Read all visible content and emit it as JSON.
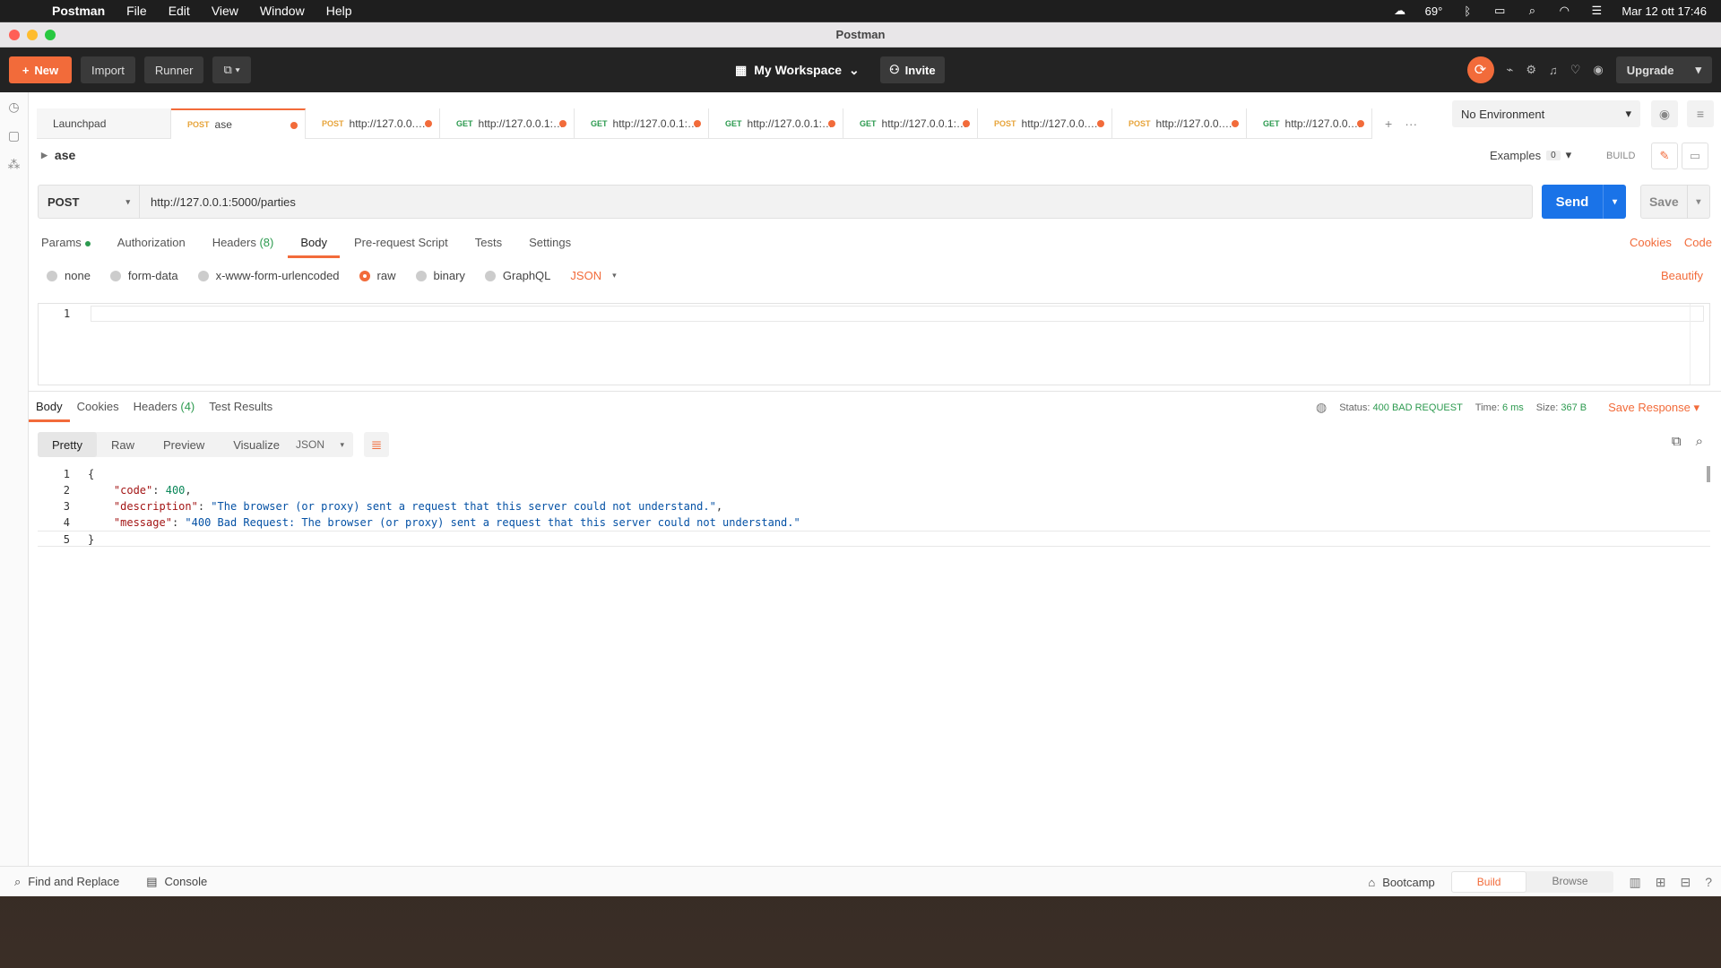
{
  "menubar": {
    "app": "Postman",
    "items": [
      "File",
      "Edit",
      "View",
      "Window",
      "Help"
    ],
    "temp": "69°",
    "datetime": "Mar 12 ott  17:46"
  },
  "window": {
    "title": "Postman"
  },
  "toolbar": {
    "new_label": "New",
    "import_label": "Import",
    "runner_label": "Runner",
    "workspace_label": "My Workspace",
    "invite_label": "Invite",
    "upgrade_label": "Upgrade"
  },
  "tabs": [
    {
      "label": "Launchpad"
    },
    {
      "method": "POST",
      "label": "ase"
    },
    {
      "method": "POST",
      "label": "http://127.0.0.1:..."
    },
    {
      "method": "GET",
      "label": "http://127.0.0.1:5..."
    },
    {
      "method": "GET",
      "label": "http://127.0.0.1:5..."
    },
    {
      "method": "GET",
      "label": "http://127.0.0.1:5..."
    },
    {
      "method": "GET",
      "label": "http://127.0.0.1:5..."
    },
    {
      "method": "POST",
      "label": "http://127.0.0.1:..."
    },
    {
      "method": "POST",
      "label": "http://127.0.0.1:..."
    },
    {
      "method": "GET",
      "label": "http://127.0.0.1:5..."
    }
  ],
  "environment": {
    "selected": "No Environment"
  },
  "request": {
    "name": "ase",
    "examples_label": "Examples",
    "examples_count": "0",
    "build_label": "BUILD",
    "method": "POST",
    "url": "http://127.0.0.1:5000/parties",
    "send_label": "Send",
    "save_label": "Save",
    "tabs": {
      "params": "Params",
      "authorization": "Authorization",
      "headers": "Headers",
      "headers_count": "(8)",
      "body": "Body",
      "prerequest": "Pre-request Script",
      "tests": "Tests",
      "settings": "Settings"
    },
    "cookies_label": "Cookies",
    "code_label": "Code",
    "body_types": {
      "none": "none",
      "form_data": "form-data",
      "urlencoded": "x-www-form-urlencoded",
      "raw": "raw",
      "binary": "binary",
      "graphql": "GraphQL",
      "format": "JSON"
    },
    "beautify_label": "Beautify",
    "editor_line": "1"
  },
  "response": {
    "tabs": {
      "body": "Body",
      "cookies": "Cookies",
      "headers": "Headers",
      "headers_count": "(4)",
      "tests": "Test Results"
    },
    "status_label": "Status:",
    "status_value": "400 BAD REQUEST",
    "time_label": "Time:",
    "time_value": "6 ms",
    "size_label": "Size:",
    "size_value": "367 B",
    "save_response_label": "Save Response",
    "views": {
      "pretty": "Pretty",
      "raw": "Raw",
      "preview": "Preview",
      "visualize": "Visualize"
    },
    "format": "JSON",
    "code_lines": {
      "l1": "{",
      "l2_key": "\"code\"",
      "l2_val": "400",
      "l3_key": "\"description\"",
      "l3_val": "\"The browser (or proxy) sent a request that this server could not understand.\"",
      "l4_key": "\"message\"",
      "l4_val": "\"400 Bad Request: The browser (or proxy) sent a request that this server could not understand.\"",
      "l5": "}"
    }
  },
  "statusbar": {
    "find_replace": "Find and Replace",
    "console": "Console",
    "bootcamp": "Bootcamp",
    "build": "Build",
    "browse": "Browse"
  },
  "colors": {
    "accent": "#f26b3a",
    "send": "#1a73e8",
    "success": "#2c9a4f"
  }
}
